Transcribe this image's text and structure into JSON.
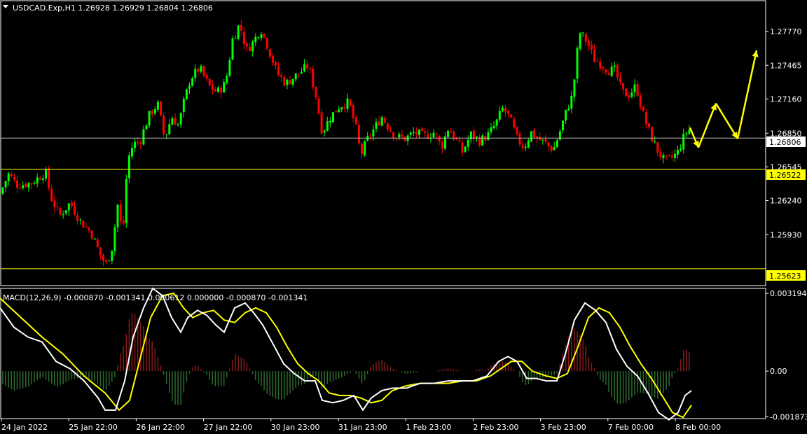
{
  "header": {
    "symbol_line": "USDCAD.Exp,H1  1.26928 1.26929 1.26804 1.26806"
  },
  "macd_header": "MACD(12,26,9) -0.000870 -0.001341 0.000612 0.000000 -0.000870 -0.001341",
  "price_levels": {
    "current": "1.26806",
    "resistance": "1.26522",
    "support": "1.25623"
  },
  "colors": {
    "background": "#000000",
    "bull": "#00ff00",
    "bear": "#ff0000",
    "frame": "#ffffff",
    "current_line": "#c0c0c0",
    "level_line": "#ffff00",
    "macd_line": "#ffffff",
    "signal_line": "#ffff00",
    "hist_positive": "#8b1a1a",
    "hist_negative": "#2e6b2e",
    "arrow": "#ffff00"
  },
  "chart_data": [
    {
      "type": "candlestick",
      "title": "USDCAD.Exp,H1",
      "ylim": [
        1.2547,
        1.2805
      ],
      "yticks": [
        "1.27770",
        "1.27465",
        "1.27160",
        "1.26850",
        "1.26545",
        "1.26240",
        "1.25930"
      ],
      "xlabels": [
        "24 Jan 2022",
        "25 Jan 22:00",
        "26 Jan 22:00",
        "27 Jan 22:00",
        "30 Jan 23:00",
        "31 Jan 23:00",
        "1 Feb 23:00",
        "2 Feb 23:00",
        "3 Feb 23:00",
        "7 Feb 00:00",
        "8 Feb 00:00"
      ],
      "close_path": [
        [
          0,
          1.263
        ],
        [
          12,
          1.2648
        ],
        [
          25,
          1.2638
        ],
        [
          45,
          1.264
        ],
        [
          65,
          1.265
        ],
        [
          72,
          1.2628
        ],
        [
          85,
          1.261
        ],
        [
          100,
          1.2622
        ],
        [
          115,
          1.2605
        ],
        [
          130,
          1.2595
        ],
        [
          145,
          1.2572
        ],
        [
          152,
          1.2566
        ],
        [
          160,
          1.2582
        ],
        [
          168,
          1.262
        ],
        [
          175,
          1.2592
        ],
        [
          182,
          1.266
        ],
        [
          190,
          1.2675
        ],
        [
          200,
          1.2678
        ],
        [
          212,
          1.27
        ],
        [
          225,
          1.2712
        ],
        [
          235,
          1.268
        ],
        [
          245,
          1.27
        ],
        [
          255,
          1.2692
        ],
        [
          262,
          1.2712
        ],
        [
          272,
          1.2735
        ],
        [
          285,
          1.2744
        ],
        [
          298,
          1.2728
        ],
        [
          310,
          1.2722
        ],
        [
          322,
          1.273
        ],
        [
          332,
          1.277
        ],
        [
          342,
          1.2784
        ],
        [
          352,
          1.276
        ],
        [
          362,
          1.2768
        ],
        [
          372,
          1.278
        ],
        [
          382,
          1.2764
        ],
        [
          395,
          1.274
        ],
        [
          408,
          1.273
        ],
        [
          420,
          1.2736
        ],
        [
          432,
          1.2742
        ],
        [
          440,
          1.2746
        ],
        [
          450,
          1.2722
        ],
        [
          460,
          1.2686
        ],
        [
          472,
          1.27
        ],
        [
          485,
          1.271
        ],
        [
          498,
          1.2713
        ],
        [
          508,
          1.269
        ],
        [
          515,
          1.2665
        ],
        [
          525,
          1.268
        ],
        [
          535,
          1.269
        ],
        [
          545,
          1.27
        ],
        [
          555,
          1.269
        ],
        [
          565,
          1.2682
        ],
        [
          578,
          1.268
        ],
        [
          592,
          1.2686
        ],
        [
          605,
          1.2682
        ],
        [
          620,
          1.2686
        ],
        [
          630,
          1.2672
        ],
        [
          640,
          1.269
        ],
        [
          650,
          1.268
        ],
        [
          660,
          1.2668
        ],
        [
          672,
          1.2684
        ],
        [
          685,
          1.2678
        ],
        [
          698,
          1.2684
        ],
        [
          708,
          1.2694
        ],
        [
          718,
          1.2708
        ],
        [
          728,
          1.2698
        ],
        [
          738,
          1.268
        ],
        [
          748,
          1.2672
        ],
        [
          758,
          1.2686
        ],
        [
          768,
          1.268
        ],
        [
          778,
          1.2676
        ],
        [
          790,
          1.267
        ],
        [
          800,
          1.2688
        ],
        [
          810,
          1.2708
        ],
        [
          818,
          1.272
        ],
        [
          822,
          1.275
        ],
        [
          828,
          1.2776
        ],
        [
          838,
          1.2768
        ],
        [
          848,
          1.2752
        ],
        [
          858,
          1.2748
        ],
        [
          868,
          1.2742
        ],
        [
          878,
          1.2742
        ],
        [
          888,
          1.2722
        ],
        [
          898,
          1.272
        ],
        [
          908,
          1.2728
        ],
        [
          918,
          1.2702
        ],
        [
          928,
          1.2684
        ],
        [
          938,
          1.267
        ],
        [
          948,
          1.266
        ],
        [
          958,
          1.2662
        ],
        [
          968,
          1.2668
        ],
        [
          975,
          1.268
        ],
        [
          983,
          1.269
        ],
        [
          987,
          1.2681
        ]
      ],
      "levels": [
        1.26806,
        1.26522,
        1.25623
      ],
      "projection_arrows": [
        [
          [
            985,
            1.269
          ],
          [
            997,
            1.2672
          ]
        ],
        [
          [
            997,
            1.2672
          ],
          [
            1022,
            1.2712
          ]
        ],
        [
          [
            1022,
            1.2712
          ],
          [
            1053,
            1.268
          ]
        ],
        [
          [
            1053,
            1.268
          ],
          [
            1080,
            1.276
          ]
        ]
      ]
    },
    {
      "type": "macd",
      "title": "MACD(12,26,9)",
      "ylim": [
        -0.00195,
        0.0034
      ],
      "yticks": [
        "0.003194",
        "0.00",
        "-0.001873"
      ],
      "macd": [
        [
          0,
          0.0026
        ],
        [
          20,
          0.0018
        ],
        [
          40,
          0.0014
        ],
        [
          60,
          0.0012
        ],
        [
          80,
          0.0004
        ],
        [
          100,
          0.0001
        ],
        [
          120,
          -0.0004
        ],
        [
          140,
          -0.0011
        ],
        [
          150,
          -0.0016
        ],
        [
          165,
          -0.0016
        ],
        [
          178,
          -0.0004
        ],
        [
          190,
          0.0014
        ],
        [
          205,
          0.0026
        ],
        [
          218,
          0.0034
        ],
        [
          232,
          0.0031
        ],
        [
          245,
          0.0022
        ],
        [
          258,
          0.0016
        ],
        [
          268,
          0.0022
        ],
        [
          282,
          0.0025
        ],
        [
          295,
          0.0023
        ],
        [
          308,
          0.0019
        ],
        [
          320,
          0.0016
        ],
        [
          335,
          0.0026
        ],
        [
          350,
          0.0028
        ],
        [
          362,
          0.0024
        ],
        [
          375,
          0.0019
        ],
        [
          390,
          0.0011
        ],
        [
          405,
          0.0003
        ],
        [
          420,
          -0.0001
        ],
        [
          435,
          -0.0004
        ],
        [
          450,
          -0.0004
        ],
        [
          460,
          -0.0012
        ],
        [
          475,
          -0.0013
        ],
        [
          490,
          -0.0012
        ],
        [
          505,
          -0.001
        ],
        [
          518,
          -0.0016
        ],
        [
          530,
          -0.0011
        ],
        [
          545,
          -0.0008
        ],
        [
          560,
          -0.0007
        ],
        [
          580,
          -0.0007
        ],
        [
          600,
          -0.0005
        ],
        [
          620,
          -0.0005
        ],
        [
          640,
          -0.0004
        ],
        [
          655,
          -0.0004
        ],
        [
          675,
          -0.0004
        ],
        [
          695,
          -0.0002
        ],
        [
          712,
          0.0004
        ],
        [
          725,
          0.0006
        ],
        [
          738,
          0.0004
        ],
        [
          752,
          -0.0003
        ],
        [
          765,
          -0.0003
        ],
        [
          780,
          -0.0004
        ],
        [
          795,
          -0.0004
        ],
        [
          808,
          0.0008
        ],
        [
          820,
          0.0021
        ],
        [
          835,
          0.0028
        ],
        [
          850,
          0.0025
        ],
        [
          865,
          0.002
        ],
        [
          880,
          0.0009
        ],
        [
          895,
          0.0002
        ],
        [
          910,
          -0.0002
        ],
        [
          925,
          -0.0009
        ],
        [
          940,
          -0.0017
        ],
        [
          955,
          -0.002
        ],
        [
          968,
          -0.0017
        ],
        [
          978,
          -0.001
        ],
        [
          987,
          -0.0008
        ]
      ],
      "signal": [
        [
          0,
          0.003
        ],
        [
          30,
          0.0022
        ],
        [
          60,
          0.0014
        ],
        [
          90,
          0.0007
        ],
        [
          120,
          -0.0002
        ],
        [
          150,
          -0.0009
        ],
        [
          170,
          -0.0016
        ],
        [
          185,
          -0.0012
        ],
        [
          200,
          0.0005
        ],
        [
          215,
          0.0022
        ],
        [
          232,
          0.0031
        ],
        [
          248,
          0.0032
        ],
        [
          262,
          0.0026
        ],
        [
          275,
          0.0022
        ],
        [
          290,
          0.0024
        ],
        [
          305,
          0.0025
        ],
        [
          320,
          0.0021
        ],
        [
          335,
          0.002
        ],
        [
          350,
          0.0024
        ],
        [
          365,
          0.0026
        ],
        [
          380,
          0.0024
        ],
        [
          395,
          0.0018
        ],
        [
          410,
          0.001
        ],
        [
          425,
          0.0003
        ],
        [
          440,
          -0.0001
        ],
        [
          455,
          -0.0004
        ],
        [
          470,
          -0.0009
        ],
        [
          485,
          -0.001
        ],
        [
          500,
          -0.001
        ],
        [
          515,
          -0.0011
        ],
        [
          530,
          -0.0013
        ],
        [
          545,
          -0.0012
        ],
        [
          560,
          -0.0008
        ],
        [
          580,
          -0.0006
        ],
        [
          600,
          -0.0005
        ],
        [
          620,
          -0.0005
        ],
        [
          640,
          -0.0005
        ],
        [
          660,
          -0.0004
        ],
        [
          680,
          -0.0004
        ],
        [
          700,
          -0.0002
        ],
        [
          715,
          0.0001
        ],
        [
          730,
          0.0004
        ],
        [
          745,
          0.0004
        ],
        [
          760,
          0.0
        ],
        [
          780,
          -0.0002
        ],
        [
          795,
          -0.0003
        ],
        [
          810,
          -0.0001
        ],
        [
          825,
          0.001
        ],
        [
          840,
          0.0022
        ],
        [
          855,
          0.0026
        ],
        [
          870,
          0.0024
        ],
        [
          885,
          0.0018
        ],
        [
          900,
          0.001
        ],
        [
          915,
          0.0003
        ],
        [
          930,
          -0.0003
        ],
        [
          945,
          -0.001
        ],
        [
          960,
          -0.0017
        ],
        [
          975,
          -0.0019
        ],
        [
          987,
          -0.0014
        ]
      ]
    }
  ]
}
